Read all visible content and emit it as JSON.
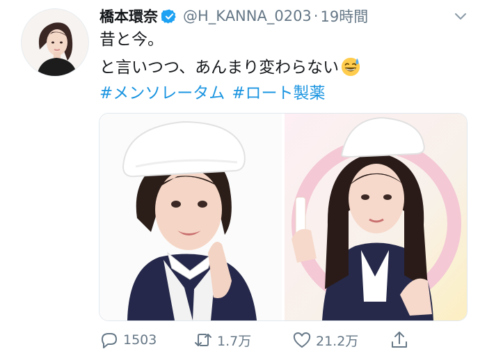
{
  "tweet": {
    "author_name": "橋本環奈",
    "handle": "@H_KANNA_0203",
    "separator": "·",
    "time": "19時間",
    "line1": "昔と今。",
    "line2": "と言いつつ、あんまり変わらない",
    "hashtags": [
      "#メンソレータム",
      "#ロート製薬"
    ]
  },
  "actions": {
    "reply_count": "1503",
    "retweet_count": "1.7万",
    "like_count": "21.2万"
  },
  "colors": {
    "link": "#1b95e0",
    "muted": "#657786",
    "verified": "#1da1f2"
  },
  "icons": [
    "verified-badge-icon",
    "chevron-down-icon",
    "grinning-sweat-emoji-icon",
    "reply-icon",
    "retweet-icon",
    "like-icon",
    "share-icon"
  ]
}
